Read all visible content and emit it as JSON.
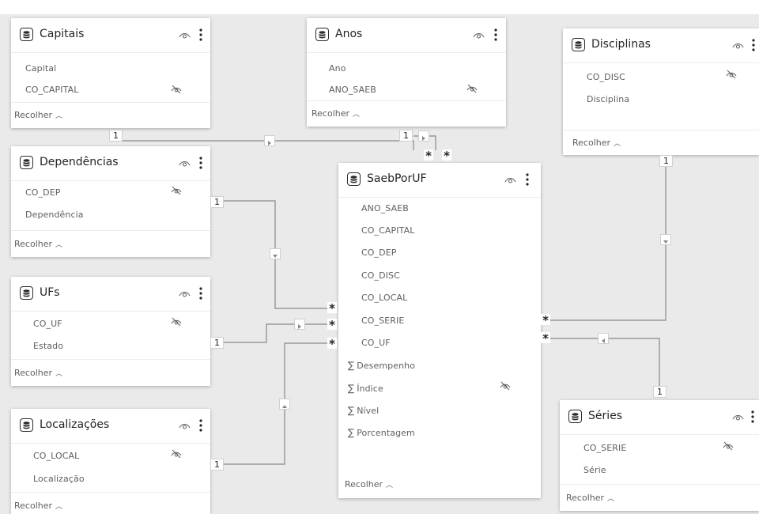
{
  "canvas": {
    "background": "#eaeaea",
    "card_background": "#ffffff",
    "line_color": "#8a8886"
  },
  "collapse_label": "Recolher",
  "tables": {
    "capitais": {
      "title": "Capitais",
      "fields": [
        "Capital",
        "CO_CAPITAL"
      ]
    },
    "anos": {
      "title": "Anos",
      "fields": [
        "Ano",
        "ANO_SAEB"
      ]
    },
    "disciplinas": {
      "title": "Disciplinas",
      "fields": [
        "CO_DISC",
        "Disciplina"
      ]
    },
    "dependencias": {
      "title": "Dependências",
      "fields": [
        "CO_DEP",
        "Dependência"
      ]
    },
    "saebporuf": {
      "title": "SaebPorUF",
      "fields": [
        "ANO_SAEB",
        "CO_CAPITAL",
        "CO_DEP",
        "CO_DISC",
        "CO_LOCAL",
        "CO_SERIE",
        "CO_UF"
      ],
      "measures": [
        "Desempenho",
        "Índice",
        "Nível",
        "Porcentagem"
      ]
    },
    "ufs": {
      "title": "UFs",
      "fields": [
        "CO_UF",
        "Estado"
      ]
    },
    "localizacoes": {
      "title": "Localizações",
      "fields": [
        "CO_LOCAL",
        "Localização"
      ]
    },
    "series": {
      "title": "Séries",
      "fields": [
        "CO_SERIE",
        "Série"
      ]
    }
  },
  "cardinality": {
    "one": "1",
    "many": "*"
  },
  "icons": {
    "table": "table-icon",
    "visibility": "eye-icon",
    "more": "more-options-icon",
    "hidden": "hidden-eye-icon",
    "measure": "sigma-icon",
    "collapse": "chevron-up-icon",
    "filter_direction": "triangle-arrow-icon"
  }
}
